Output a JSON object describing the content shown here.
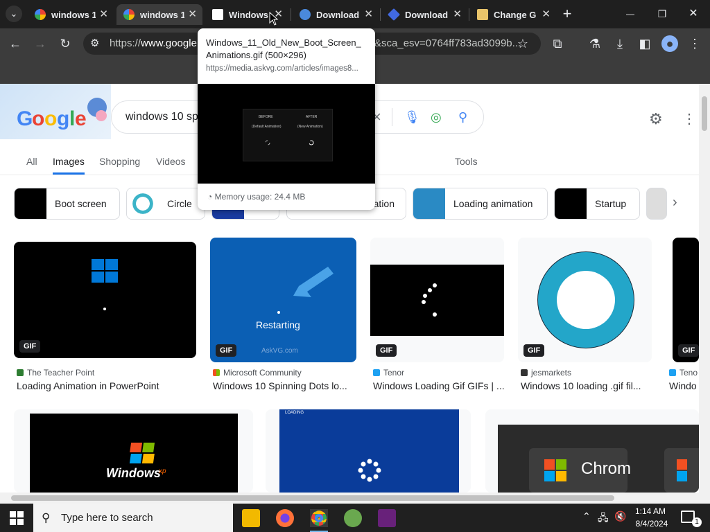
{
  "tabs": [
    {
      "title": "windows 1",
      "close": "✕"
    },
    {
      "title": "windows 1",
      "close": "✕"
    },
    {
      "title": "Windows",
      "close": "✕"
    },
    {
      "title": "Download",
      "close": "✕"
    },
    {
      "title": "Download",
      "close": "✕"
    },
    {
      "title": "Change G",
      "close": "✕"
    }
  ],
  "window": {
    "new_tab": "+",
    "minimize": "—",
    "maximize": "❐",
    "close": "✕"
  },
  "address": {
    "prefix": "https://",
    "host": "www.google.c",
    "tail": "&sca_esv=0764ff783ad3099b..."
  },
  "tooltip": {
    "title": "Windows_11_Old_New_Boot_Screen_Animations.gif (500×296)",
    "url": "https://media.askvg.com/articles/images8...",
    "memory": "Memory usage: 24.4 MB",
    "preview_before": "BEFORE",
    "preview_before_sub": "(Default Animation)",
    "preview_after": "AFTER",
    "preview_after_sub": "(New Animation)"
  },
  "search": {
    "query": "windows 10 sp"
  },
  "nav": {
    "all": "All",
    "images": "Images",
    "shopping": "Shopping",
    "videos": "Videos",
    "tools": "Tools"
  },
  "chips": [
    "Boot screen",
    "Circle",
    "ation",
    "Loading animation",
    "Startup"
  ],
  "results": [
    {
      "source": "The Teacher Point",
      "title": "Loading Animation in PowerPoint",
      "badge": "GIF"
    },
    {
      "source": "Microsoft Community",
      "title": "Windows 10 Spinning Dots lo...",
      "badge": "GIF",
      "caption": "Restarting",
      "watermark": "AskVG.com"
    },
    {
      "source": "Tenor",
      "title": "Windows Loading Gif GIFs | ...",
      "badge": "GIF"
    },
    {
      "source": "jesmarkets",
      "title": "Windows 10 loading .gif fil...",
      "badge": "GIF"
    },
    {
      "source": "Teno",
      "title": "Windo",
      "badge": "GIF"
    }
  ],
  "row2": {
    "xp_brand": "Windows",
    "xp_sup": "xp",
    "chrome": "Chrom",
    "loading": "LOADING"
  },
  "taskbar": {
    "search_placeholder": "Type here to search",
    "time": "1:14 AM",
    "date": "8/4/2024",
    "notif": "1"
  },
  "colors": {
    "tabbar": "#1f1f1f",
    "toolbar": "#3c3c3c",
    "accent": "#1a73e8",
    "taskbar": "#202020"
  }
}
